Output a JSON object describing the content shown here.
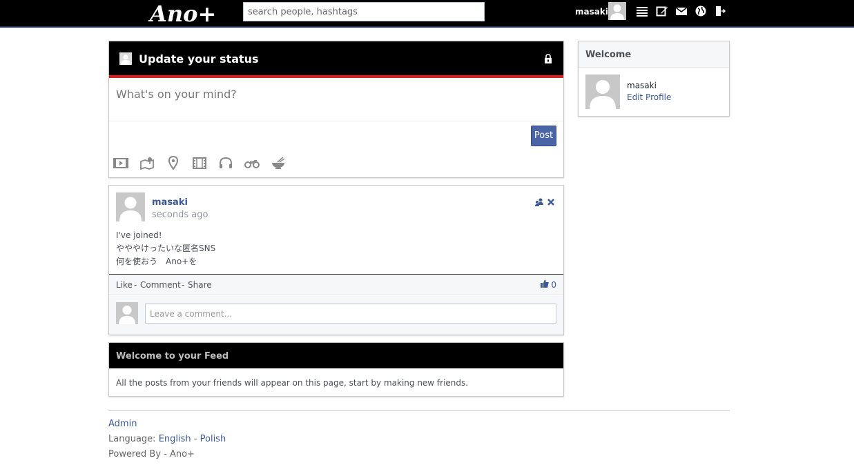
{
  "topbar": {
    "logo": "Ano+",
    "search_placeholder": "search people, hashtags",
    "username": "masaki",
    "icons": [
      "list-icon",
      "edit-icon",
      "mail-icon",
      "globe-icon",
      "logout-icon"
    ]
  },
  "status": {
    "title": "Update your status",
    "placeholder": "What's on your mind?",
    "post_label": "Post",
    "attach_icons": [
      "video-icon",
      "map-icon",
      "location-pin-icon",
      "film-icon",
      "headphones-icon",
      "motorcycle-icon",
      "food-bowl-icon"
    ]
  },
  "post": {
    "author": "masaki",
    "time": "seconds ago",
    "lines": [
      "I've joined!",
      "やややけったいな匿名SNS",
      "何を使おう　Ano+を"
    ],
    "like": "Like",
    "comment": "Comment",
    "share": "Share",
    "separator": "-",
    "likes": "0",
    "comment_placeholder": "Leave a comment..."
  },
  "feed": {
    "title": "Welcome to your Feed",
    "text": "All the posts from your friends will appear on this page, start by making new friends."
  },
  "sidebar": {
    "title": "Welcome",
    "name": "masaki",
    "edit_profile": "Edit Profile"
  },
  "footer": {
    "admin": "Admin",
    "language_label": "Language:",
    "lang_english": "English",
    "lang_sep": "-",
    "lang_polish": "Polish",
    "powered": "Powered By - Ano+"
  },
  "colors": {
    "topbar": "#000000",
    "accent_red": "#e21b1b",
    "link_blue": "#3b5998",
    "post_button": "#4a64a5"
  }
}
